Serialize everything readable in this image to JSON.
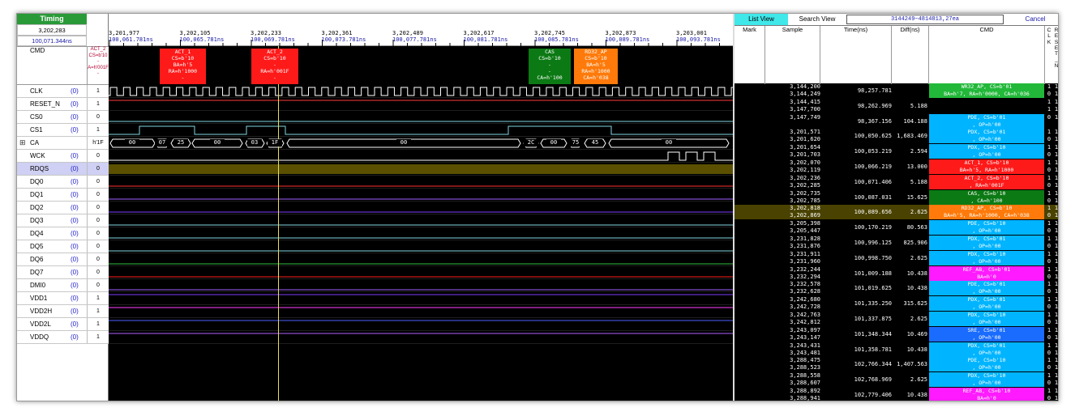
{
  "app": {
    "timing_label": "Timing",
    "sample": "3,202,283",
    "time": "100,071.344ns",
    "cmd_label": "CMD",
    "cmd_value": "ACT_2\nCS=b'10\n-\nA=h'001F\n-"
  },
  "signals": [
    {
      "name": "CLK",
      "zero": "(0)",
      "value": "1",
      "icon": ""
    },
    {
      "name": "RESET_N",
      "zero": "(0)",
      "value": "1",
      "icon": ""
    },
    {
      "name": "CS0",
      "zero": "(0)",
      "value": "0",
      "icon": ""
    },
    {
      "name": "CS1",
      "zero": "(0)",
      "value": "1",
      "icon": ""
    },
    {
      "name": "CA",
      "zero": "",
      "value": "h'1F",
      "icon": "⊞"
    },
    {
      "name": "WCK",
      "zero": "(0)",
      "value": "0",
      "icon": ""
    },
    {
      "name": "RDQS",
      "zero": "(0)",
      "value": "0",
      "icon": ""
    },
    {
      "name": "DQ0",
      "zero": "(0)",
      "value": "0",
      "icon": ""
    },
    {
      "name": "DQ1",
      "zero": "(0)",
      "value": "0",
      "icon": ""
    },
    {
      "name": "DQ2",
      "zero": "(0)",
      "value": "0",
      "icon": ""
    },
    {
      "name": "DQ3",
      "zero": "(0)",
      "value": "0",
      "icon": ""
    },
    {
      "name": "DQ4",
      "zero": "(0)",
      "value": "0",
      "icon": ""
    },
    {
      "name": "DQ5",
      "zero": "(0)",
      "value": "0",
      "icon": ""
    },
    {
      "name": "DQ6",
      "zero": "(0)",
      "value": "0",
      "icon": ""
    },
    {
      "name": "DQ7",
      "zero": "(0)",
      "value": "0",
      "icon": ""
    },
    {
      "name": "DMI0",
      "zero": "(0)",
      "value": "0",
      "icon": ""
    },
    {
      "name": "VDD1",
      "zero": "(0)",
      "value": "1",
      "icon": ""
    },
    {
      "name": "VDD2H",
      "zero": "(0)",
      "value": "1",
      "icon": ""
    },
    {
      "name": "VDD2L",
      "zero": "(0)",
      "value": "1",
      "icon": ""
    },
    {
      "name": "VDDQ",
      "zero": "(0)",
      "value": "1",
      "icon": ""
    }
  ],
  "signal_colors": [
    "#ffffff",
    "#ff3a3a",
    "#7fd6e0",
    "#7fd6e0",
    "#ffffff",
    "#ffffff",
    "#6b5e00",
    "#ff3030",
    "#a060ff",
    "#7a3aff",
    "#7fd6e0",
    "#7fd6e0",
    "#7fd6e0",
    "#30c040",
    "#ff2020",
    "#a060ff",
    "#7a3aff",
    "#ff40ff",
    "#4a60ff",
    "#b060ff"
  ],
  "ruler": [
    {
      "sample": "3,201,977",
      "time": "100,061.781ns"
    },
    {
      "sample": "3,202,105",
      "time": "100,065.781ns"
    },
    {
      "sample": "3,202,233",
      "time": "100,069.781ns"
    },
    {
      "sample": "3,202,361",
      "time": "100,073.781ns"
    },
    {
      "sample": "3,202,489",
      "time": "100,077.781ns"
    },
    {
      "sample": "3,202,617",
      "time": "100,081.781ns"
    },
    {
      "sample": "3,202,745",
      "time": "100,085.781ns"
    },
    {
      "sample": "3,202,873",
      "time": "100,089.781ns"
    },
    {
      "sample": "3,203,001",
      "time": "100,093.781ns"
    }
  ],
  "cmd_boxes": [
    {
      "text": "ACT_1\nCS=b'10\nBA=h'5\nRA=h'1000\n-",
      "color": "#ff1a1a"
    },
    {
      "text": "ACT_2\nCS=b'10\n-\nRA=h'001F\n-",
      "color": "#ff1a1a"
    },
    {
      "text": "CAS\nCS=b'10\n-\n-\nCA=h'100",
      "color": "#0c7a14"
    },
    {
      "text": "RD32_AP\nCS=b'10\nBA=h'5\nRA=h'1000\nCA=h'038",
      "color": "#ff7a0a"
    }
  ],
  "ca_labels": [
    "00",
    "07",
    "25",
    "00",
    "03",
    "1F",
    "00",
    "2C",
    "00",
    "75",
    "45",
    "00"
  ],
  "list": {
    "tab_list": "List View",
    "tab_search": "Search View",
    "search_value": "3144249~4814813,27ea",
    "cancel": "Cancel",
    "headers": {
      "mark": "Mark",
      "sample": "Sample",
      "time": "Time(ns)",
      "diff": "Diff(ns)",
      "cmd": "CMD",
      "clk": "CLK",
      "reset": "RESET_N"
    },
    "rows": [
      {
        "sample": "3,144,200\n3,144,249",
        "time": "98,257.781",
        "diff": "",
        "cmd": "WR32_AP, CS=b'01\nBA=h'7, RA=h'0000, CA=h'036",
        "color": "#22b83a",
        "b1": "1\n0",
        "b2": "1\n1"
      },
      {
        "sample": "3,144,415\n3,147,700",
        "time": "98,262.969",
        "diff": "5.188",
        "cmd": "",
        "color": "",
        "b1": "1\n1",
        "b2": "1\n1"
      },
      {
        "sample": "3,147,749",
        "time": "98,367.156",
        "diff": "104.188",
        "cmd": "PDE, CS=b'01\n, OP=h'00",
        "color": "#00b4ff",
        "b1": "0",
        "b2": "1"
      },
      {
        "sample": "3,201,571\n3,201,620",
        "time": "100,050.625",
        "diff": "1,683.469",
        "cmd": "PDX, CS=b'01\n, OP=h'00",
        "color": "#00b4ff",
        "b1": "1\n0",
        "b2": "1\n1"
      },
      {
        "sample": "3,201,654\n3,201,703",
        "time": "100,053.219",
        "diff": "2.594",
        "cmd": "PDX, CS=b'10\n, OP=h'00",
        "color": "#00b4ff",
        "b1": "1\n0",
        "b2": "1\n1"
      },
      {
        "sample": "3,202,070\n3,202,119",
        "time": "100,066.219",
        "diff": "13.000",
        "cmd": "ACT_1, CS=b'10\nBA=h'5, RA=h'1000",
        "color": "#ff1a1a",
        "b1": "1\n0",
        "b2": "1\n1"
      },
      {
        "sample": "3,202,236\n3,202,285",
        "time": "100,071.406",
        "diff": "5.188",
        "cmd": "ACT_2, CS=b'10\n, RA=h'001F",
        "color": "#ff1a1a",
        "b1": "1\n0",
        "b2": "1\n1"
      },
      {
        "sample": "3,202,735\n3,202,785",
        "time": "100,087.031",
        "diff": "15.625",
        "cmd": "CAS, CS=b'10\n, CA=h'100",
        "color": "#0c7a14",
        "b1": "1\n0",
        "b2": "1\n1"
      },
      {
        "sample": "3,202,818\n3,202,869",
        "time": "100,089.656",
        "diff": "2.625",
        "cmd": "RD32_AP, CS=b'10\nBA=h'5, RA=h'1000, CA=h'038",
        "color": "#ff7a0a",
        "b1": "1\n0",
        "b2": "1\n1",
        "hl": true
      },
      {
        "sample": "3,205,398\n3,205,447",
        "time": "100,170.219",
        "diff": "80.563",
        "cmd": "PDE, CS=b'10\n, OP=h'00",
        "color": "#00b4ff",
        "b1": "1\n0",
        "b2": "1\n1"
      },
      {
        "sample": "3,231,828\n3,231,876",
        "time": "100,996.125",
        "diff": "825.906",
        "cmd": "PDX, CS=b'01\n, OP=h'00",
        "color": "#00b4ff",
        "b1": "1\n0",
        "b2": "1\n1"
      },
      {
        "sample": "3,231,911\n3,231,960",
        "time": "100,998.750",
        "diff": "2.625",
        "cmd": "PDX, CS=b'10\n, OP=h'00",
        "color": "#00b4ff",
        "b1": "1\n0",
        "b2": "1\n1"
      },
      {
        "sample": "3,232,244\n3,232,294",
        "time": "101,009.188",
        "diff": "10.438",
        "cmd": "REF_AB, CS=b'01\nBA=h'0",
        "color": "#ff1aff",
        "b1": "1\n0",
        "b2": "1\n1"
      },
      {
        "sample": "3,232,578\n3,232,628",
        "time": "101,019.625",
        "diff": "10.438",
        "cmd": "PDE, CS=b'01\n, OP=h'00",
        "color": "#00b4ff",
        "b1": "1\n0",
        "b2": "1\n1"
      },
      {
        "sample": "3,242,680\n3,242,728",
        "time": "101,335.250",
        "diff": "315.625",
        "cmd": "PDX, CS=b'01\n, OP=h'00",
        "color": "#00b4ff",
        "b1": "1\n0",
        "b2": "1\n1"
      },
      {
        "sample": "3,242,763\n3,242,812",
        "time": "101,337.875",
        "diff": "2.625",
        "cmd": "PDX, CS=b'10\n, OP=h'00",
        "color": "#00b4ff",
        "b1": "1\n0",
        "b2": "1\n1"
      },
      {
        "sample": "3,243,097\n3,243,147",
        "time": "101,348.344",
        "diff": "10.469",
        "cmd": "SRE, CS=b'01\n, OP=h'00",
        "color": "#1a6cff",
        "b1": "1\n0",
        "b2": "1\n1"
      },
      {
        "sample": "3,243,431\n3,243,481",
        "time": "101,358.781",
        "diff": "10.438",
        "cmd": "PDX, CS=b'01\n, OP=h'00",
        "color": "#00b4ff",
        "b1": "1\n0",
        "b2": "1\n1"
      },
      {
        "sample": "3,288,475\n3,288,523",
        "time": "102,766.344",
        "diff": "1,407.563",
        "cmd": "PDE, CS=b'10\n, OP=h'00",
        "color": "#00b4ff",
        "b1": "1\n0",
        "b2": "1\n1"
      },
      {
        "sample": "3,288,558\n3,288,607",
        "time": "102,768.969",
        "diff": "2.625",
        "cmd": "PDX, CS=b'10\n, OP=h'00",
        "color": "#00b4ff",
        "b1": "1\n0",
        "b2": "1\n1"
      },
      {
        "sample": "3,288,892\n3,288,941",
        "time": "102,779.406",
        "diff": "10.438",
        "cmd": "REF_AB, CS=b'10\nBA=h'0",
        "color": "#ff1aff",
        "b1": "1\n0",
        "b2": "1\n1"
      }
    ]
  }
}
